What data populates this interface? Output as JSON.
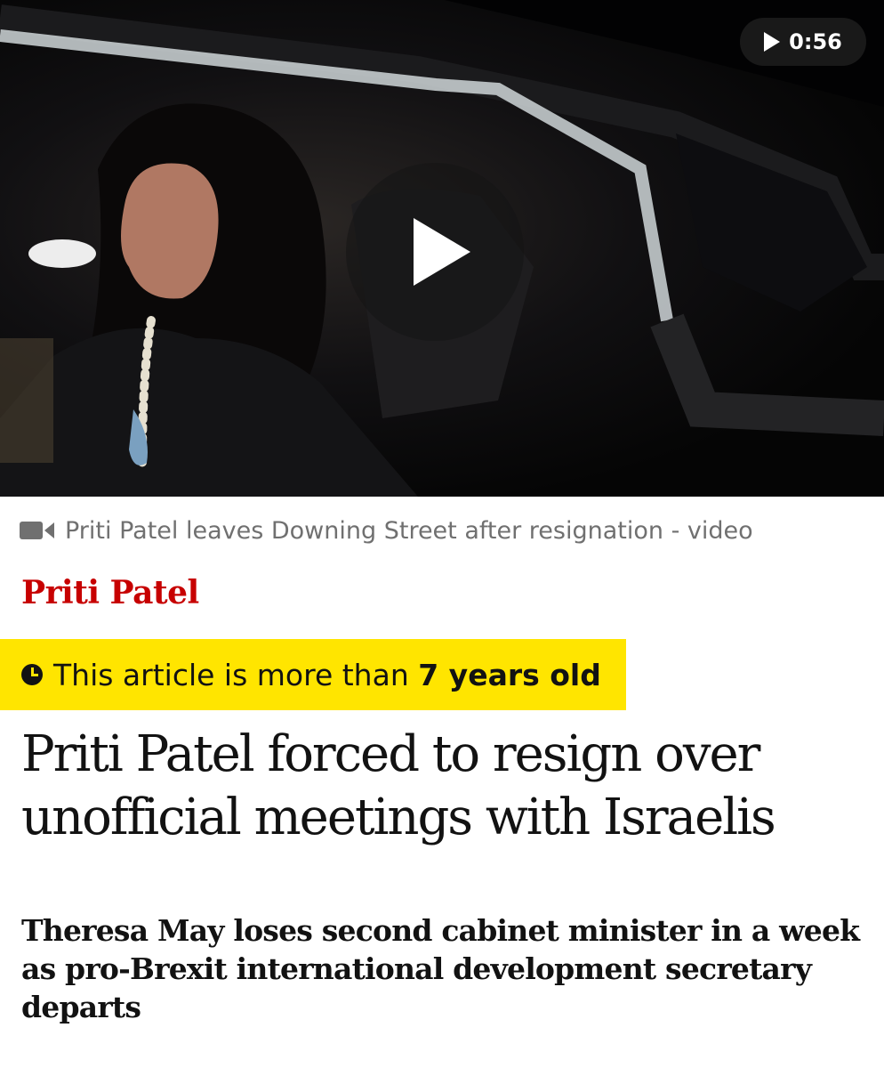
{
  "video": {
    "duration": "0:56",
    "play_icon": "play-icon"
  },
  "caption": {
    "icon": "video-camera-icon",
    "text": "Priti Patel leaves Downing Street after resignation - video"
  },
  "kicker": "Priti Patel",
  "age_warning": {
    "icon": "clock-icon",
    "prefix": "This article is more than ",
    "age": "7 years old",
    "background": "#ffe500"
  },
  "headline": "Priti Patel forced to resign over unofficial meetings with Israelis",
  "standfirst": "Theresa May loses second cabinet minister in a week as pro-Brexit international development secretary departs",
  "colors": {
    "kicker": "#c70000",
    "text": "#121212",
    "caption": "#707070"
  }
}
